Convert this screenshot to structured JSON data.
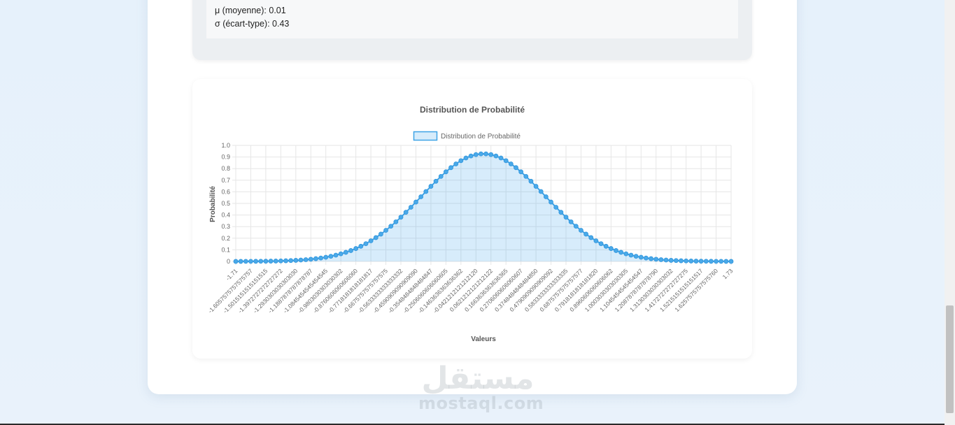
{
  "stats": {
    "mu_line": "μ (moyenne): 0.01",
    "sigma_line": "σ (écart-type): 0.43"
  },
  "watermark": {
    "arabic": "مستقل",
    "latin": "mostaql.com"
  },
  "chart_data": {
    "type": "line",
    "title": "Distribution de Probabilité",
    "xlabel": "Valeurs",
    "ylabel": "Probabilité",
    "legend": "Distribution de Probabilité",
    "legend_position": "top",
    "grid": true,
    "fill": true,
    "ylim": [
      0,
      1
    ],
    "yticks": [
      "0",
      "0.1",
      "0.2",
      "0.3",
      "0.4",
      "0.5",
      "0.6",
      "0.7",
      "0.8",
      "0.9",
      "1.0"
    ],
    "xlim": [
      -1.71,
      1.73
    ],
    "mu": 0.01,
    "sigma": 0.43,
    "series": [
      {
        "name": "Distribution de Probabilité",
        "x_start": -1.71,
        "x_end": 1.73,
        "point_count": 100
      }
    ],
    "x_tick_labels": [
      "-1.71",
      "-1.6057575757575757",
      "-1.5015151515151515",
      "-1.3972727272727272",
      "-1.2930303030303030",
      "-1.1887878787878787",
      "-1.0845454545454545",
      "-0.9803030303030302",
      "-0.8760606060606060",
      "-0.7718181818181817",
      "-0.6675757575757575",
      "-0.5633333333333332",
      "-0.4590909090909090",
      "-0.3548484848484847",
      "-0.2506060606060605",
      "-0.1463636363636362",
      "-0.0421212121212120",
      "0.0621212121212122",
      "0.1663636363636365",
      "0.2706060606060607",
      "0.3748484848484850",
      "0.4790909090909092",
      "0.5833333333333335",
      "0.6875757575757577",
      "0.7918181818181820",
      "0.8960606060606062",
      "1.0003030303030305",
      "1.1045454545454547",
      "1.2087878787878790",
      "1.3130303030303032",
      "1.4172727272727275",
      "1.5215151515151517",
      "1.6257575757575760",
      "1.73"
    ],
    "colors": {
      "line": "#3ea3e6",
      "fill": "rgba(54,162,235,0.2)",
      "point": "#4aa9e9",
      "grid": "#e6e6e6",
      "text": "#666666"
    }
  }
}
